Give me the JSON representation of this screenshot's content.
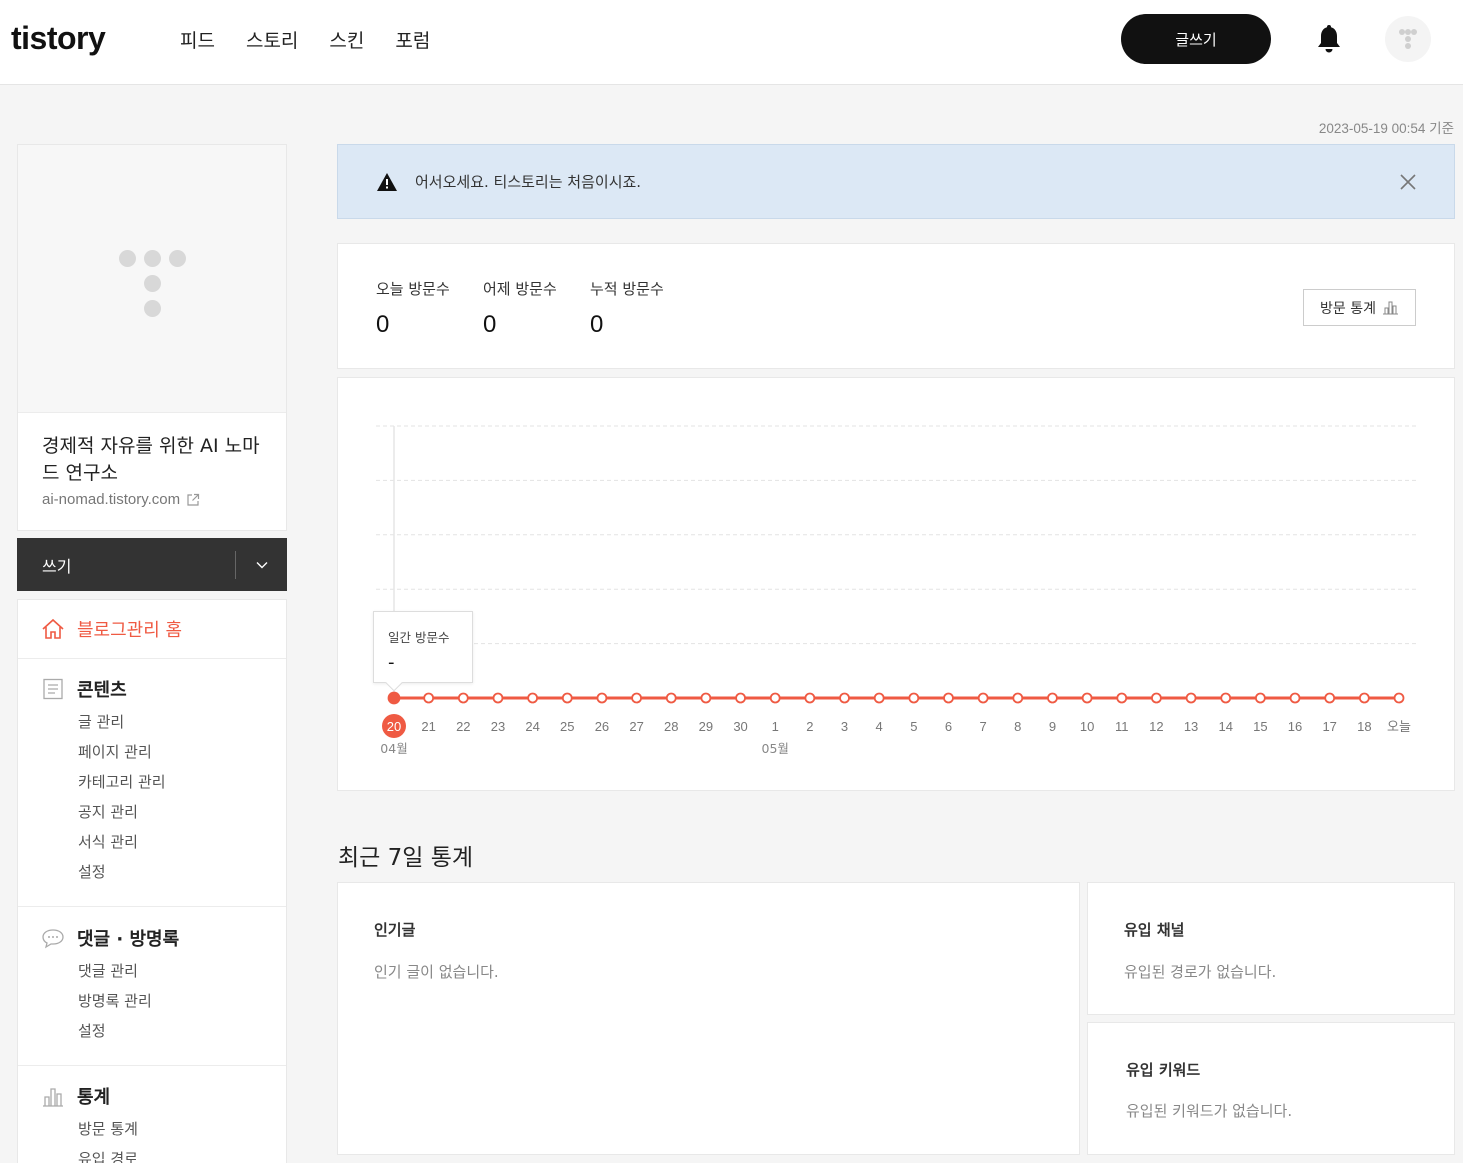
{
  "header": {
    "logo": "tistory",
    "nav": [
      "피드",
      "스토리",
      "스킨",
      "포럼"
    ],
    "write_label": "글쓰기"
  },
  "timestamp": "2023-05-19 00:54 기준",
  "sidebar": {
    "blog_title": "경제적 자유를 위한 AI 노마드 연구소",
    "blog_url": "ai-nomad.tistory.com",
    "write_label": "쓰기",
    "home_label": "블로그관리 홈",
    "sections": [
      {
        "title": "콘텐츠",
        "icon": "document-icon",
        "items": [
          "글 관리",
          "페이지 관리",
          "카테고리 관리",
          "공지 관리",
          "서식 관리",
          "설정"
        ]
      },
      {
        "title": "댓글 · 방명록",
        "icon": "speech-bubble-icon",
        "items": [
          "댓글 관리",
          "방명록 관리",
          "설정"
        ]
      },
      {
        "title": "통계",
        "icon": "bar-chart-icon",
        "items": [
          "방문 통계",
          "유입 경로"
        ]
      }
    ]
  },
  "alert": {
    "message": "어서오세요. 티스토리는 처음이시죠."
  },
  "stats": {
    "today_label": "오늘 방문수",
    "today_value": "0",
    "yesterday_label": "어제 방문수",
    "yesterday_value": "0",
    "total_label": "누적 방문수",
    "total_value": "0",
    "visit_stats_button": "방문 통계"
  },
  "tooltip": {
    "title": "일간 방문수",
    "value": "-"
  },
  "colors": {
    "accent": "#ef5a43",
    "dark": "#111111",
    "alert_bg": "#dce8f5"
  },
  "chart_data": {
    "type": "line",
    "x": [
      "20",
      "21",
      "22",
      "23",
      "24",
      "25",
      "26",
      "27",
      "28",
      "29",
      "30",
      "1",
      "2",
      "3",
      "4",
      "5",
      "6",
      "7",
      "8",
      "9",
      "10",
      "11",
      "12",
      "13",
      "14",
      "15",
      "16",
      "17",
      "18",
      "오늘"
    ],
    "month_labels": [
      {
        "index": 0,
        "label": "04월"
      },
      {
        "index": 11,
        "label": "05월"
      }
    ],
    "series": [
      {
        "values": [
          0,
          0,
          0,
          0,
          0,
          0,
          0,
          0,
          0,
          0,
          0,
          0,
          0,
          0,
          0,
          0,
          0,
          0,
          0,
          0,
          0,
          0,
          0,
          0,
          0,
          0,
          0,
          0,
          0,
          0
        ]
      }
    ],
    "highlighted_index": 0,
    "grid": true
  },
  "recent": {
    "title": "최근 7일 통계",
    "popular_title": "인기글",
    "popular_empty": "인기 글이 없습니다.",
    "channel_title": "유입 채널",
    "channel_empty": "유입된 경로가 없습니다.",
    "keyword_title": "유입 키워드",
    "keyword_empty": "유입된 키워드가 없습니다."
  }
}
